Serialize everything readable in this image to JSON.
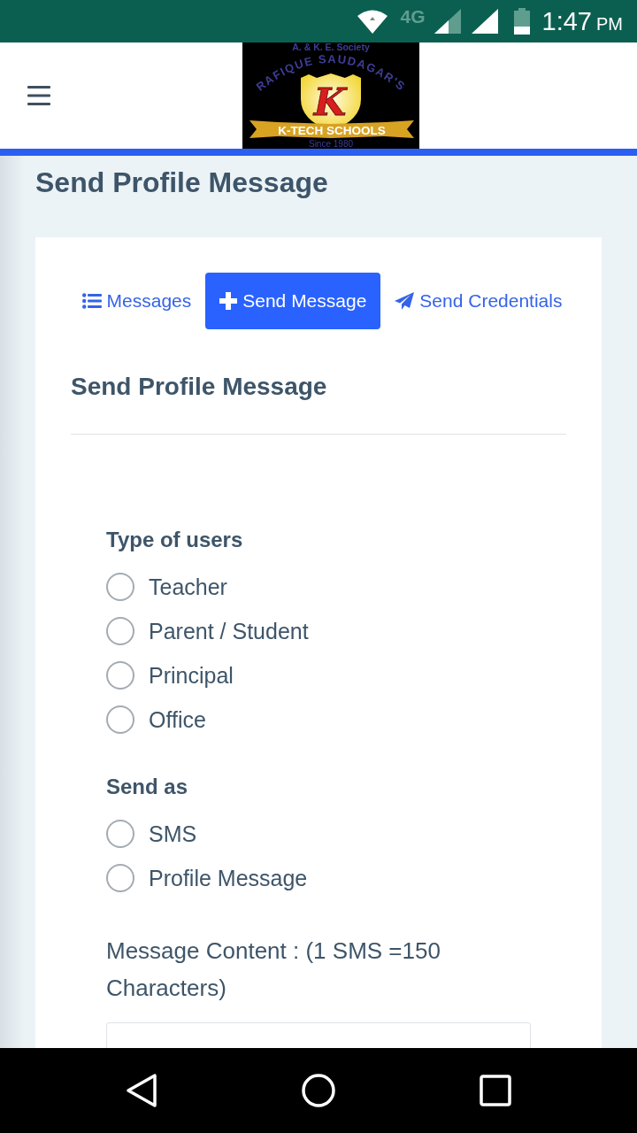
{
  "status_bar": {
    "network": "4G",
    "time": "1:47",
    "meridiem": "PM"
  },
  "logo": {
    "society": "A. & K. E. Society",
    "arc": "RAFIQUE SAUDAGAR'S",
    "letter": "K",
    "banner": "K-TECH SCHOOLS",
    "since": "Since 1980"
  },
  "page_title": "Send Profile Message",
  "tabs": [
    {
      "label": "Messages",
      "selected": false
    },
    {
      "label": "Send Message",
      "selected": true
    },
    {
      "label": "Send Credentials",
      "selected": false
    }
  ],
  "form": {
    "title": "Send Profile Message",
    "groups": [
      {
        "label": "Type of users",
        "options": [
          {
            "label": "Teacher",
            "selected": false
          },
          {
            "label": "Parent / Student",
            "selected": false
          },
          {
            "label": "Principal",
            "selected": false
          },
          {
            "label": "Office",
            "selected": false
          }
        ]
      },
      {
        "label": "Send as",
        "options": [
          {
            "label": "SMS",
            "selected": false
          },
          {
            "label": "Profile Message",
            "selected": false
          }
        ]
      }
    ],
    "message": {
      "label": "Message Content : (1 SMS =150 Characters)"
    }
  }
}
